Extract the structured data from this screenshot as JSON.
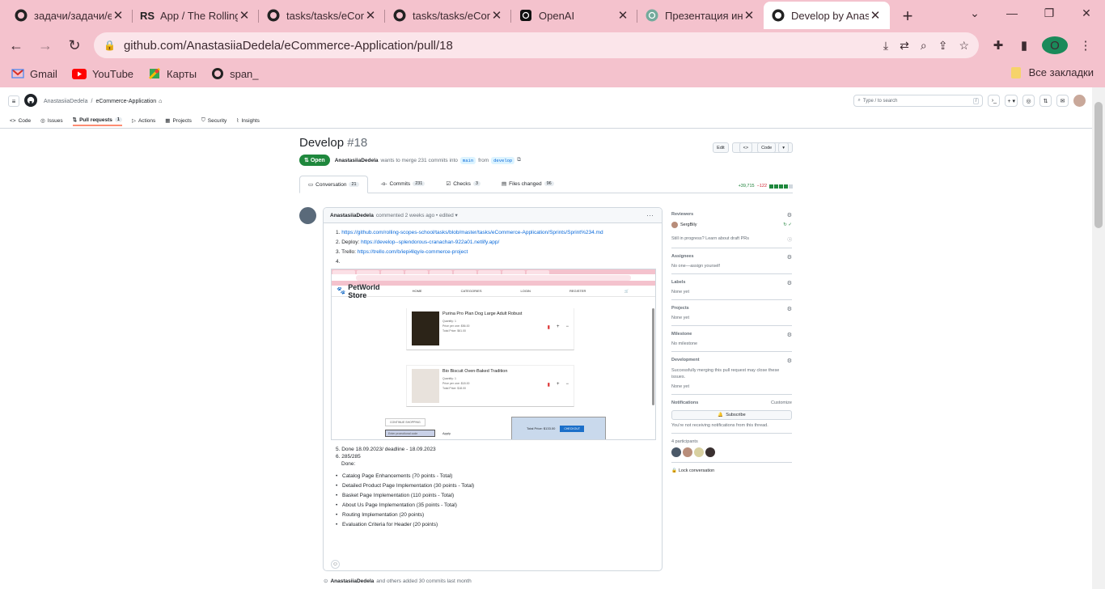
{
  "browser": {
    "tabs": [
      {
        "title": "задачи/задачи/e",
        "icon": "github-icon",
        "active": false
      },
      {
        "title": "App / The Rolling",
        "icon": "rs-icon",
        "active": false
      },
      {
        "title": "tasks/tasks/eCom",
        "icon": "github-icon",
        "active": false
      },
      {
        "title": "tasks/tasks/eCom",
        "icon": "github-icon",
        "active": false
      },
      {
        "title": "OpenAI",
        "icon": "openai-icon",
        "active": false
      },
      {
        "title": "Презентация ин",
        "icon": "chatgpt-icon",
        "active": false
      },
      {
        "title": "Develop by Anast",
        "icon": "github-icon",
        "active": true
      }
    ],
    "url": "github.com/AnastasiiaDedela/eCommerce-Application/pull/18",
    "profile_letter": "O",
    "bookmarks": [
      {
        "label": "Gmail",
        "icon": "gmail-icon"
      },
      {
        "label": "YouTube",
        "icon": "youtube-icon"
      },
      {
        "label": "Карты",
        "icon": "maps-icon"
      },
      {
        "label": "span_",
        "icon": "globe-icon"
      }
    ],
    "all_bookmarks": "Все закладки"
  },
  "github": {
    "owner": "AnastasiiaDedela",
    "repo": "eCommerce-Application",
    "search_placeholder": "Type / to search",
    "repo_tabs": [
      {
        "label": "Code",
        "icon": "code-icon"
      },
      {
        "label": "Issues",
        "icon": "issue-icon"
      },
      {
        "label": "Pull requests",
        "icon": "pr-icon",
        "count": "1",
        "selected": true
      },
      {
        "label": "Actions",
        "icon": "play-icon"
      },
      {
        "label": "Projects",
        "icon": "table-icon"
      },
      {
        "label": "Security",
        "icon": "shield-icon"
      },
      {
        "label": "Insights",
        "icon": "graph-icon"
      }
    ]
  },
  "pr": {
    "title": "Develop",
    "number": "#18",
    "edit_label": "Edit",
    "code_label": "Code",
    "state": "Open",
    "author": "AnastasiiaDedela",
    "merge_text": "wants to merge 231 commits into",
    "base_branch": "main",
    "from_text": "from",
    "head_branch": "develop",
    "tabs": [
      {
        "label": "Conversation",
        "count": "21"
      },
      {
        "label": "Commits",
        "count": "231"
      },
      {
        "label": "Checks",
        "count": "3"
      },
      {
        "label": "Files changed",
        "count": "96"
      }
    ],
    "additions": "+39,715",
    "deletions": "−122"
  },
  "comment": {
    "author": "AnastasiiaDedela",
    "meta": "commented 2 weeks ago • edited ▾",
    "items": [
      {
        "n": "1.",
        "text": "https://github.com/rolling-scopes-school/tasks/blob/master/tasks/eCommerce-Application/Sprints/Sprint%234.md",
        "link": true
      },
      {
        "n": "2.",
        "prefix": "Deploy: ",
        "text": "https://develop--splendorous-cranachan-922a01.netlify.app/",
        "link": true
      },
      {
        "n": "3.",
        "prefix": "Trello: ",
        "text": "https://trello.com/b/iepi4lqy/e-commerce-project",
        "link": true
      },
      {
        "n": "4.",
        "text": ""
      }
    ],
    "screenshot": {
      "store_name": "PetWorld Store",
      "nav": [
        "HOME",
        "CATEGORIES",
        "LOGIN",
        "REGISTER"
      ],
      "products": [
        {
          "name": "Purina Pro Plan Dog Large Adult Robust",
          "details": [
            "Quantity: 1",
            "Price per one: $56.00",
            "Total Price: $61.00"
          ]
        },
        {
          "name": "Bio Biscuit Oven-Baked Tradition",
          "details": [
            "Quantity: 1",
            "Price per one: $18.00",
            "Total Price: $18.00"
          ]
        }
      ],
      "continue_label": "CONTINUE SHOPPING",
      "promo_placeholder": "Enter promotional code",
      "apply_label": "Apply",
      "total_text": "Total Price: $133.00",
      "checkout_label": "CHECKOUT"
    },
    "after": [
      {
        "n": "5.",
        "text": "Done 18.09.2023/ deadline - 18.09.2023"
      },
      {
        "n": "6.",
        "text": "285/285"
      },
      {
        "n": "",
        "text": "Done:"
      }
    ],
    "done_list": [
      "Catalog Page Enhancements (70 points - Total)",
      "Detailed Product Page Implementation (30 points - Total)",
      "Basket Page Implementation (110 points - Total)",
      "About Us Page Implementation (35 points - Total)",
      "Routing Implementation (20 points)",
      "Evaluation Criteria for Header (20 points)"
    ]
  },
  "sidebar": {
    "reviewers_title": "Reviewers",
    "reviewer": "SergBily",
    "draft_note": "Still in progress? Learn about draft PRs",
    "assignees_title": "Assignees",
    "assignees_value": "No one—assign yourself",
    "labels_title": "Labels",
    "labels_value": "None yet",
    "projects_title": "Projects",
    "projects_value": "None yet",
    "milestone_title": "Milestone",
    "milestone_value": "No milestone",
    "development_title": "Development",
    "development_text": "Successfully merging this pull request may close these issues.",
    "development_value": "None yet",
    "notifications_title": "Notifications",
    "customize": "Customize",
    "subscribe": "Subscribe",
    "notif_note": "You're not receiving notifications from this thread.",
    "participants": "4 participants",
    "lock": "Lock conversation"
  },
  "timeline": {
    "author": "AnastasiiaDedela",
    "text": "and others added 30 commits last month"
  }
}
